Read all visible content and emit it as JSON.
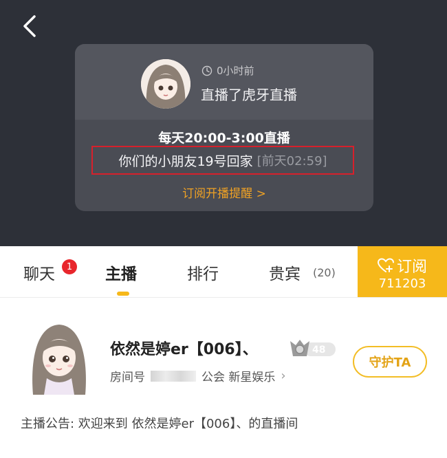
{
  "card": {
    "time_ago": "0小时前",
    "live_text": "直播了虎牙直播",
    "schedule": "每天20:00-3:00直播",
    "notice_text": "你们的小朋友19号回家",
    "notice_time": "[前天02:59]",
    "subscribe_reminder": "订阅开播提醒 >"
  },
  "tabs": {
    "chat": "聊天",
    "chat_badge": "1",
    "anchor": "主播",
    "rank": "排行",
    "vip": "贵宾",
    "vip_count": "(20)"
  },
  "subscribe": {
    "label": "订阅",
    "count": "711203"
  },
  "profile": {
    "name": "依然是婷er【006】、",
    "level": "48",
    "room_label": "房间号",
    "guild": "公会 新星娱乐",
    "guard_button": "守护TA",
    "announcement": "主播公告: 欢迎来到 依然是婷er【006】、的直播间"
  },
  "colors": {
    "accent": "#f6b81a",
    "link_orange": "#f0a224",
    "badge_red": "#e8262c",
    "highlight_box": "#d8202b",
    "dark_bg": "#2d3038"
  }
}
